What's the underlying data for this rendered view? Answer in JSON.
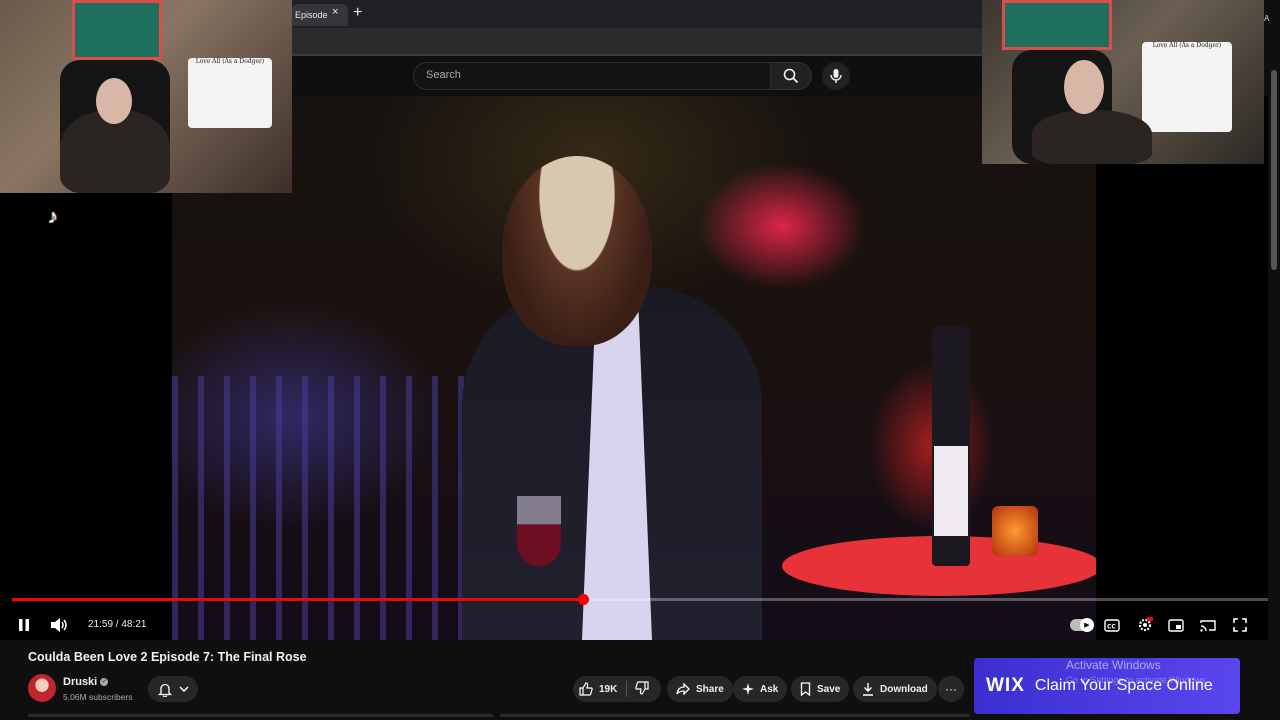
{
  "browser": {
    "tab_title": "Episode",
    "tab_close": "×",
    "new_tab": "+"
  },
  "header": {
    "search_placeholder": "Search"
  },
  "player": {
    "time_display": "21:59 / 48:21",
    "progress_fraction": 0.455,
    "paused": false
  },
  "video": {
    "title": "Coulda Been Love 2 Episode 7: The Final Rose",
    "channel": "Druski",
    "subscribers": "5.06M subscribers",
    "likes": "19K"
  },
  "actions": {
    "share": "Share",
    "ask": "Ask",
    "save": "Save",
    "download": "Download",
    "more": "···"
  },
  "ad": {
    "logo": "WIX",
    "text": "Claim Your Space Online"
  },
  "overlay": {
    "activate_windows": "Activate Windows",
    "activate_sub": "Go to Settings to activate Windows.",
    "side_note": "A"
  },
  "stream_props": {
    "shirt_text": "Love All (As a Dodger)"
  },
  "icons": {
    "tiktok": "tiktok-icon",
    "search": "search-icon",
    "mic": "mic-icon",
    "pause": "pause-icon",
    "volume": "volume-icon",
    "bell": "bell-icon",
    "like": "thumbs-up-icon",
    "dislike": "thumbs-down-icon",
    "share": "share-icon",
    "ask": "sparkle-icon",
    "save": "bookmark-icon",
    "download": "download-icon",
    "captions": "captions-icon",
    "settings": "gear-icon",
    "miniplayer": "miniplayer-icon",
    "cast": "cast-icon",
    "fullscreen": "fullscreen-icon"
  },
  "colors": {
    "progress": "#ff0000",
    "ad_bg": "#4a3be0",
    "background": "#0f0f0f"
  }
}
